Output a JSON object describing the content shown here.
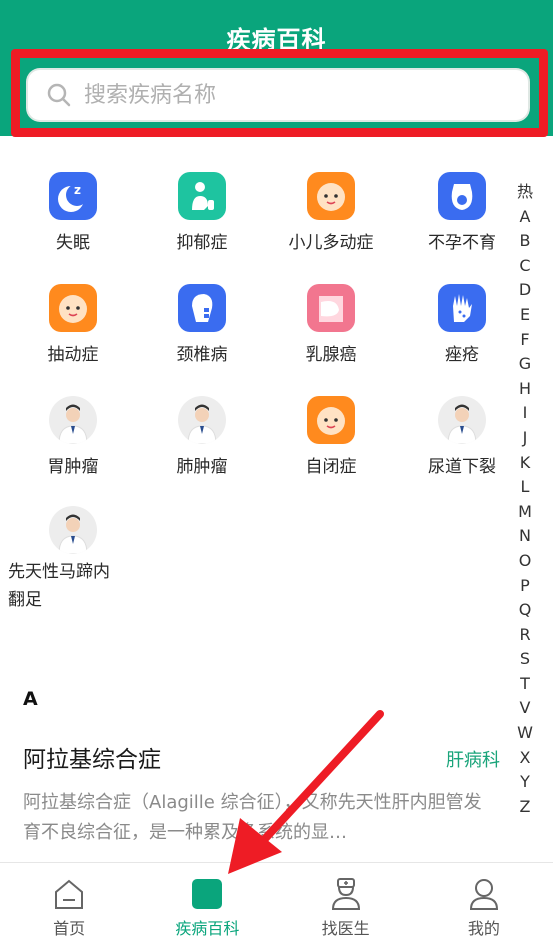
{
  "header": {
    "title": "疾病百科"
  },
  "search": {
    "placeholder": "搜索疾病名称"
  },
  "categories": [
    {
      "label": "失眠",
      "icon": "moon-sleep-icon"
    },
    {
      "label": "抑郁症",
      "icon": "sad-person-icon"
    },
    {
      "label": "小儿多动症",
      "icon": "child-face-icon"
    },
    {
      "label": "不孕不育",
      "icon": "womb-icon"
    },
    {
      "label": "抽动症",
      "icon": "child-face-icon"
    },
    {
      "label": "颈椎病",
      "icon": "neck-spine-icon"
    },
    {
      "label": "乳腺癌",
      "icon": "breast-icon"
    },
    {
      "label": "痤疮",
      "icon": "hand-dots-icon"
    },
    {
      "label": "胃肿瘤",
      "icon": "doctor-avatar-icon"
    },
    {
      "label": "肺肿瘤",
      "icon": "doctor-avatar-icon"
    },
    {
      "label": "自闭症",
      "icon": "child-face-icon"
    },
    {
      "label": "尿道下裂",
      "icon": "doctor-avatar-icon"
    },
    {
      "label": "先天性马蹄内翻足",
      "icon": "doctor-avatar-icon"
    }
  ],
  "alpha_index": [
    "热",
    "A",
    "B",
    "C",
    "D",
    "E",
    "F",
    "G",
    "H",
    "I",
    "J",
    "K",
    "L",
    "M",
    "N",
    "O",
    "P",
    "Q",
    "R",
    "S",
    "T",
    "V",
    "W",
    "X",
    "Y",
    "Z"
  ],
  "section": {
    "letter": "A",
    "item": {
      "title": "阿拉基综合症",
      "tag": "肝病科",
      "desc": "阿拉基综合症（Alagille 综合征），又称先天性肝内胆管发育不良综合征，是一种累及多系统的显…"
    }
  },
  "tabs": [
    {
      "label": "首页",
      "icon": "home-icon",
      "active": false
    },
    {
      "label": "疾病百科",
      "icon": "encyclopedia-icon",
      "active": true
    },
    {
      "label": "找医生",
      "icon": "doctor-icon",
      "active": false
    },
    {
      "label": "我的",
      "icon": "profile-icon",
      "active": false
    }
  ],
  "colors": {
    "brand": "#0aa57c",
    "highlight": "#ee1c25",
    "tag": "#1aa47a"
  }
}
